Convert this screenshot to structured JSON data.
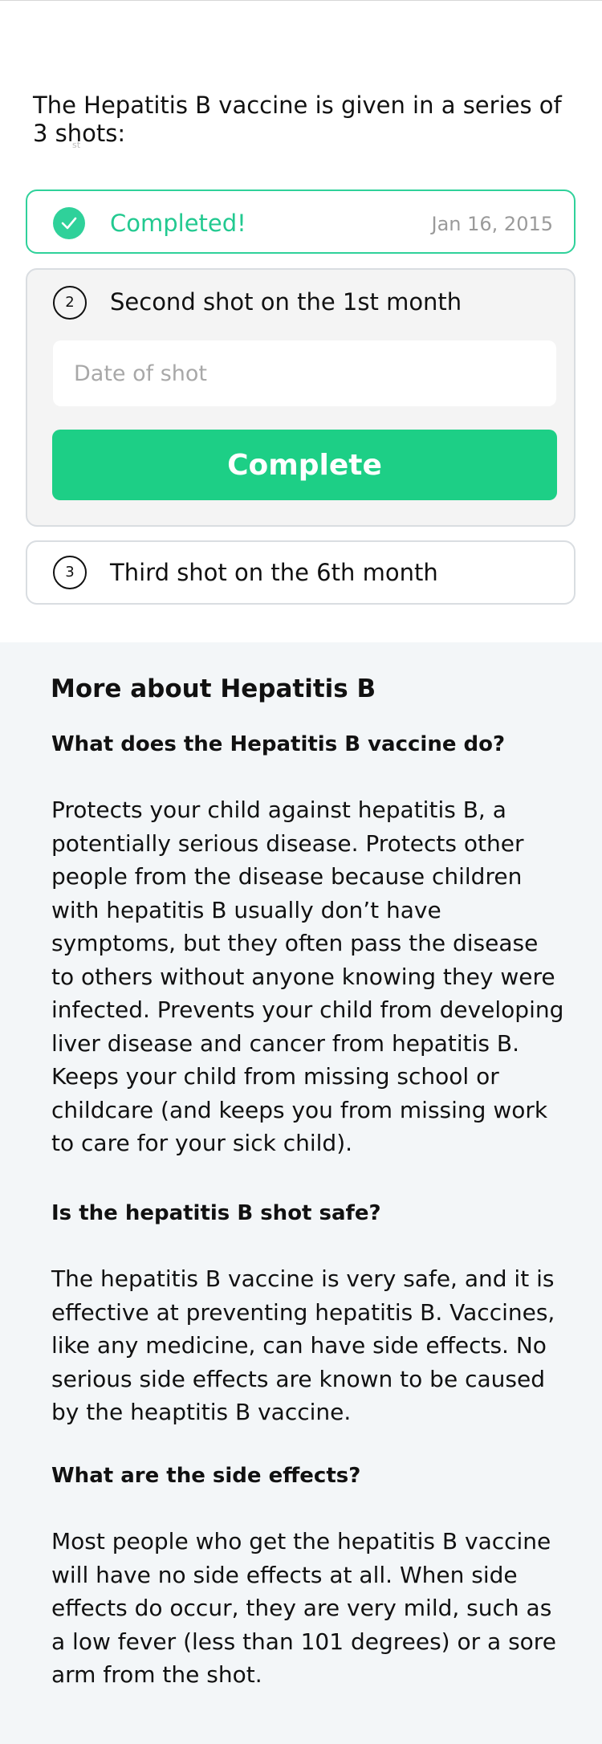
{
  "intro": {
    "text": "The Hepatitis B vaccine is given in a series of 3 shots:",
    "superscript": "st"
  },
  "shots": {
    "completed": {
      "label": "Completed!",
      "date": "Jan 16, 2015"
    },
    "second": {
      "number": "2",
      "label": "Second shot on the 1st month",
      "date_placeholder": "Date of shot",
      "date_value": "",
      "button_label": "Complete"
    },
    "third": {
      "number": "3",
      "label": "Third shot on the 6th month"
    }
  },
  "more": {
    "title": "More about Hepatitis B",
    "items": [
      {
        "question": "What does the Hepatitis B vaccine do?",
        "answer": "Protects your child against hepatitis B, a potentially serious disease. Protects other people from the disease because children with hepatitis B usually don’t have symptoms, but they often pass the disease to others without anyone knowing they were infected. Prevents your child from developing liver disease and cancer from hepatitis B. Keeps your child from missing school or childcare (and keeps you from missing work to care for your sick child)."
      },
      {
        "question": "Is the hepatitis B shot safe?",
        "answer": "The hepatitis B vaccine is very safe, and it is effective at preventing hepatitis B. Vaccines, like any medicine, can have side effects. No serious side effects are known to be caused by the heaptitis B vaccine."
      },
      {
        "question": "What are the side effects?",
        "answer": "Most people who get the hepatitis B vaccine will have no side effects at all. When side effects do occur, they are very mild, such as a low fever (less than 101 degrees) or a sore arm from the shot."
      }
    ]
  },
  "colors": {
    "accent": "#1dcf86",
    "completed_border": "#2fd19a",
    "card_border": "#d9dde1",
    "section_background": "#f3f6f8"
  }
}
